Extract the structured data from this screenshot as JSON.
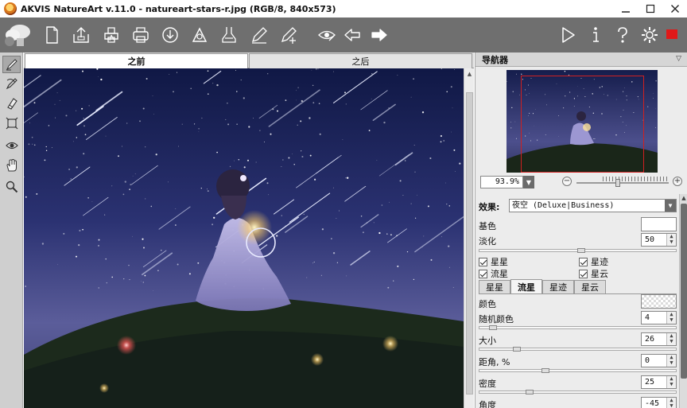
{
  "window": {
    "title": "AKVIS NatureArt v.11.0 - natureart-stars-r.jpg (RGB/8, 840x573)",
    "controls": [
      "minimize-icon",
      "maximize-icon",
      "close-icon"
    ]
  },
  "toolbar": {
    "left_icons": [
      "open-icon",
      "save-icon",
      "print-icon",
      "share-icon",
      "import-preset-icon",
      "export-preset-icon",
      "load-stroke-icon",
      "save-stroke-icon",
      "batch-icon",
      "undo-icon",
      "redo-icon"
    ],
    "right_icons": [
      "run-icon",
      "info-icon",
      "help-icon",
      "settings-icon",
      "stop-icon"
    ]
  },
  "tools": [
    "brush-icon",
    "history-brush-icon",
    "eraser-icon",
    "transform-icon",
    "mask-icon",
    "hand-icon",
    "zoom-icon"
  ],
  "canvas": {
    "tab_before": "之前",
    "tab_after": "之后"
  },
  "navigator": {
    "title": "导航器",
    "zoom": "93.9%"
  },
  "settings": {
    "effect_label": "效果:",
    "effect_value": "夜空 (Deluxe|Business)",
    "base_color_label": "基色",
    "fade_label": "淡化",
    "fade_value": "50",
    "checkboxes": {
      "stars": "星星",
      "star_trails": "星迹",
      "meteors": "流星",
      "nebula": "星云"
    },
    "subtabs": [
      "星星",
      "流星",
      "星迹",
      "星云"
    ],
    "color_label": "颜色",
    "random_color_label": "随机颜色",
    "random_color_value": "4",
    "size_label": "大小",
    "size_value": "26",
    "distance_label": "距角, %",
    "distance_value": "0",
    "density_label": "密度",
    "density_value": "25",
    "angle_label": "角度",
    "angle_value": "-45"
  },
  "colors": {
    "toolbar_bg": "#6f6f6f",
    "stop_button": "#e01818",
    "navigator_frame": "#d02020"
  }
}
